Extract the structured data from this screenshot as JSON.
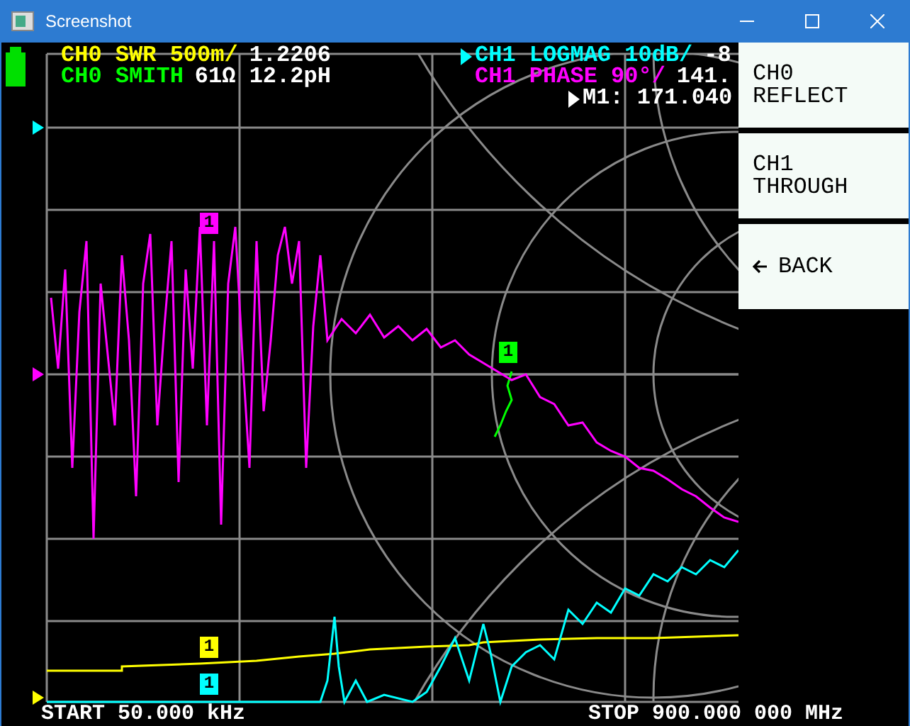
{
  "window": {
    "title": "Screenshot"
  },
  "traces": [
    {
      "label": "CH0 SWR 500m/",
      "value": "1.2206",
      "color": "#ffff00",
      "active": false
    },
    {
      "label": "CH0 SMITH",
      "value": "61Ω 12.2pH",
      "color": "#00ff00",
      "active": false
    },
    {
      "label": "CH1 LOGMAG 10dB/",
      "value": "-8",
      "color": "#00ffff",
      "active": true
    },
    {
      "label": "CH1 PHASE 90°/",
      "value": "141.",
      "color": "#ff00ff",
      "active": false
    }
  ],
  "markers": [
    {
      "label": "1",
      "color": "#ff00ff"
    },
    {
      "label": "1",
      "color": "#00ff00"
    },
    {
      "label": "1",
      "color": "#ffff00"
    },
    {
      "label": "1",
      "color": "#00ffff"
    }
  ],
  "marker_readout": {
    "label": "M1:",
    "value": "171.040"
  },
  "menu": [
    {
      "kind": "option",
      "lines": [
        "CH0",
        "REFLECT"
      ]
    },
    {
      "kind": "option",
      "lines": [
        "CH1",
        "THROUGH"
      ]
    },
    {
      "kind": "back",
      "lines": [
        "BACK"
      ]
    }
  ],
  "footer": {
    "start": "START 50.000 kHz",
    "stop": "STOP 900.000 000 MHz"
  }
}
